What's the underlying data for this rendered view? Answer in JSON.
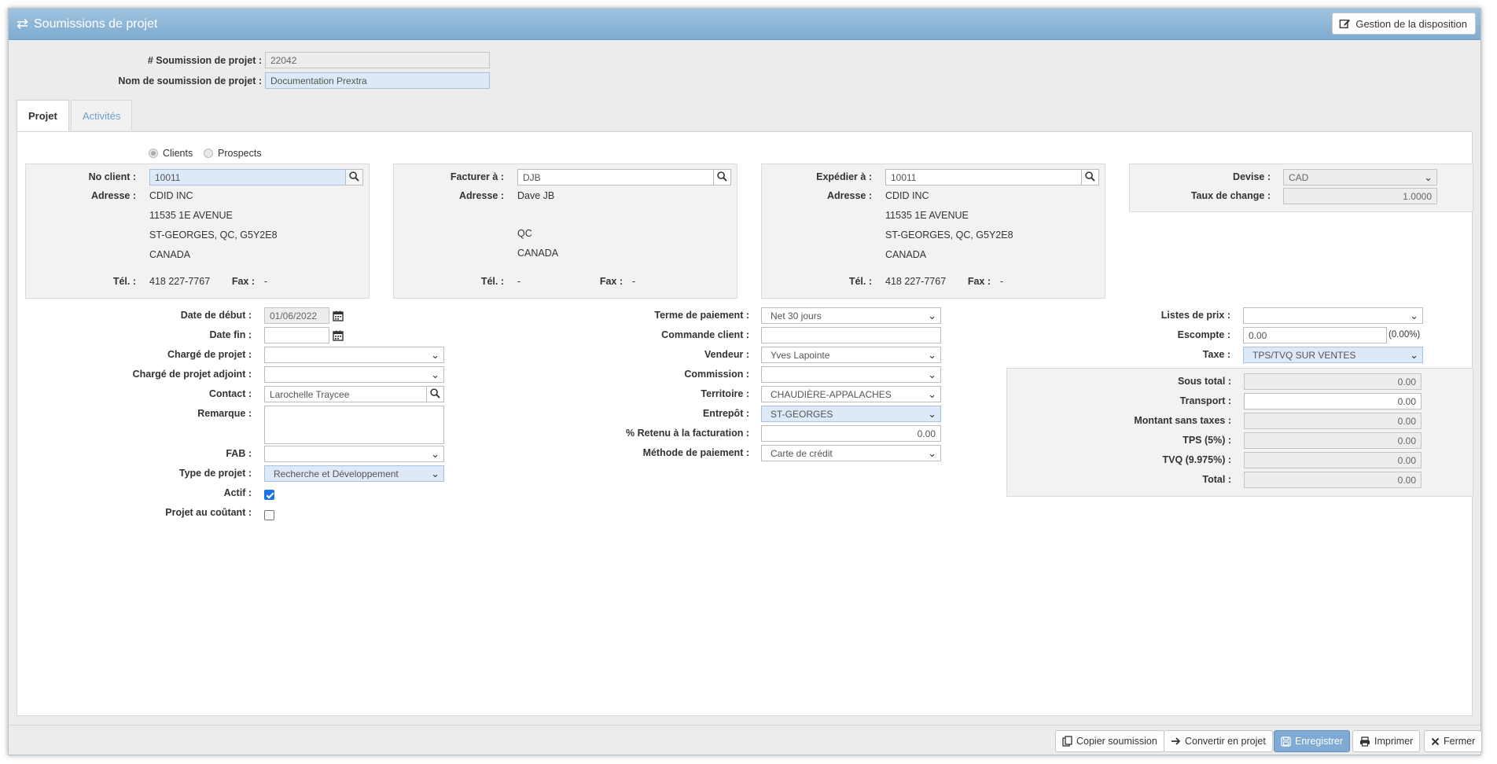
{
  "window": {
    "title": "Soumissions de projet",
    "layout_button": "Gestion de la disposition"
  },
  "header": {
    "number_label": "# Soumission de projet :",
    "number_value": "22042",
    "name_label": "Nom de soumission de projet :",
    "name_value": "Documentation Prextra"
  },
  "tabs": [
    {
      "label": "Projet",
      "active": true
    },
    {
      "label": "Activités",
      "active": false
    }
  ],
  "client_type": {
    "options": [
      "Clients",
      "Prospects"
    ],
    "selected": "Clients"
  },
  "client_box": {
    "no_label": "No client :",
    "no_value": "10011",
    "address_label": "Adresse :",
    "address": [
      "CDID INC",
      "11535 1E AVENUE",
      "ST-GEORGES, QC, G5Y2E8",
      "CANADA"
    ],
    "tel_label": "Tél. :",
    "tel": "418 227-7767",
    "fax_label": "Fax :",
    "fax": "-"
  },
  "billing_box": {
    "to_label": "Facturer à :",
    "to_value": "DJB",
    "address_label": "Adresse :",
    "address": [
      "Dave JB",
      "",
      "QC",
      "CANADA"
    ],
    "tel_label": "Tél. :",
    "tel": "-",
    "fax_label": "Fax :",
    "fax": "-"
  },
  "shipping_box": {
    "to_label": "Expédier à :",
    "to_value": "10011",
    "address_label": "Adresse :",
    "address": [
      "CDID INC",
      "11535 1E AVENUE",
      "ST-GEORGES, QC, G5Y2E8",
      "CANADA"
    ],
    "tel_label": "Tél. :",
    "tel": "418 227-7767",
    "fax_label": "Fax :",
    "fax": "-"
  },
  "currency_box": {
    "devise_label": "Devise :",
    "devise_value": "CAD",
    "rate_label": "Taux de change :",
    "rate_value": "1.0000"
  },
  "left_form": {
    "start_label": "Date de début :",
    "start_value": "01/06/2022",
    "end_label": "Date fin :",
    "end_value": "",
    "manager_label": "Chargé de projet :",
    "manager_value": "",
    "assistant_label": "Chargé de projet adjoint :",
    "assistant_value": "",
    "contact_label": "Contact :",
    "contact_value": "Larochelle Traycee",
    "remark_label": "Remarque :",
    "remark_value": "",
    "fab_label": "FAB :",
    "fab_value": "",
    "type_label": "Type de projet :",
    "type_value": "Recherche et Développement",
    "active_label": "Actif :",
    "active_checked": true,
    "cost_label": "Projet au coûtant :",
    "cost_checked": false
  },
  "middle_form": {
    "terms_label": "Terme de paiement :",
    "terms_value": "Net 30 jours",
    "order_label": "Commande client :",
    "order_value": "",
    "seller_label": "Vendeur :",
    "seller_value": "Yves Lapointe",
    "commission_label": "Commission :",
    "commission_value": "",
    "territory_label": "Territoire :",
    "territory_value": "CHAUDIÈRE-APPALACHES",
    "warehouse_label": "Entrepôt :",
    "warehouse_value": "ST-GEORGES",
    "retain_label": "% Retenu à la facturation :",
    "retain_value": "0.00",
    "method_label": "Méthode de paiement :",
    "method_value": "Carte de crédit"
  },
  "right_form": {
    "pricelist_label": "Listes de prix :",
    "pricelist_value": "",
    "discount_label": "Escompte :",
    "discount_value": "0.00",
    "discount_pct": "(0.00%)",
    "tax_label": "Taxe :",
    "tax_value": "TPS/TVQ SUR VENTES"
  },
  "totals": [
    {
      "label": "Sous total :",
      "value": "0.00",
      "editable": false
    },
    {
      "label": "Transport :",
      "value": "0.00",
      "editable": true
    },
    {
      "label": "Montant sans taxes :",
      "value": "0.00",
      "editable": false
    },
    {
      "label": "TPS (5%) :",
      "value": "0.00",
      "editable": false
    },
    {
      "label": "TVQ (9.975%) :",
      "value": "0.00",
      "editable": false
    },
    {
      "label": "Total :",
      "value": "0.00",
      "editable": false
    }
  ],
  "footer": {
    "copy": "Copier soumission",
    "convert": "Convertir en projet",
    "save": "Enregistrer",
    "print": "Imprimer",
    "close": "Fermer"
  },
  "colors": {
    "titlebar": "#8db6d9",
    "primary_button": "#7eaad3",
    "tab_link": "#6a9fd1",
    "highlight_field": "#dde9f7"
  }
}
